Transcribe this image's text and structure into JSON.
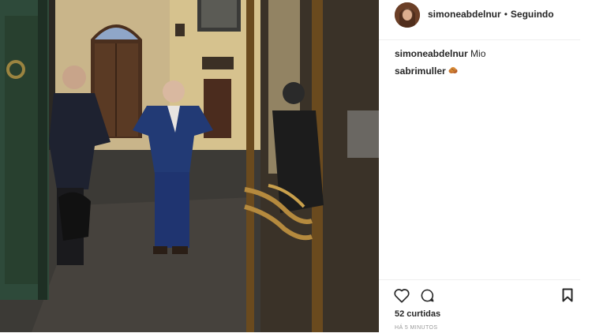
{
  "post": {
    "author": "simoneabdelnur",
    "separator": "•",
    "follow_status": "Seguindo",
    "comments": [
      {
        "user": "simoneabdelnur",
        "text": "Mio"
      },
      {
        "user": "sabrimuller",
        "text": "",
        "emoji": "cookie-icon"
      }
    ],
    "likes_text": "52 curtidas",
    "time_text": "HÁ 5 MINUTOS"
  },
  "icons": {
    "like": "heart-outline-icon",
    "comment": "speech-bubble-icon",
    "save": "bookmark-icon"
  },
  "colors": {
    "text": "#262626",
    "muted": "#999999",
    "divider": "#efefef"
  }
}
